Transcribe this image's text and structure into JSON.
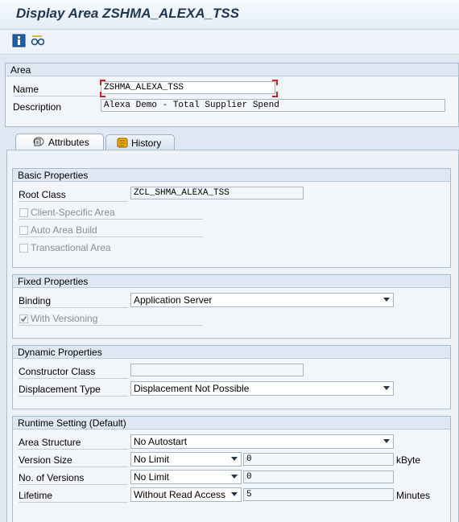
{
  "window": {
    "title": "Display Area ZSHMA_ALEXA_TSS"
  },
  "toolbar": {
    "icons": [
      "info-icon",
      "glasses-icon"
    ]
  },
  "area": {
    "section_title": "Area",
    "name_label": "Name",
    "name_value": "ZSHMA_ALEXA_TSS",
    "description_label": "Description",
    "description_value": "Alexa Demo - Total Supplier Spend"
  },
  "tabs": [
    {
      "label": "Attributes",
      "icon": "attributes-icon",
      "active": true
    },
    {
      "label": "History",
      "icon": "history-icon",
      "active": false
    }
  ],
  "basic": {
    "title": "Basic Properties",
    "root_class_label": "Root Class",
    "root_class_value": "ZCL_SHMA_ALEXA_TSS",
    "client_specific": "Client-Specific Area",
    "auto_build": "Auto Area Build",
    "transactional": "Transactional Area"
  },
  "fixed": {
    "title": "Fixed Properties",
    "binding_label": "Binding",
    "binding_value": "Application Server",
    "versioning": "With Versioning"
  },
  "dynamic": {
    "title": "Dynamic Properties",
    "constructor_label": "Constructor Class",
    "constructor_value": "",
    "displacement_label": "Displacement Type",
    "displacement_value": "Displacement Not Possible"
  },
  "runtime": {
    "title": "Runtime Setting (Default)",
    "structure_label": "Area Structure",
    "structure_value": "No Autostart",
    "version_size_label": "Version Size",
    "version_size_select": "No Limit",
    "version_size_value": "0",
    "version_size_unit": "kByte",
    "versions_label": "No. of Versions",
    "versions_select": "No Limit",
    "versions_value": "0",
    "lifetime_label": "Lifetime",
    "lifetime_select": "Without Read Access",
    "lifetime_value": "5",
    "lifetime_unit": "Minutes"
  }
}
